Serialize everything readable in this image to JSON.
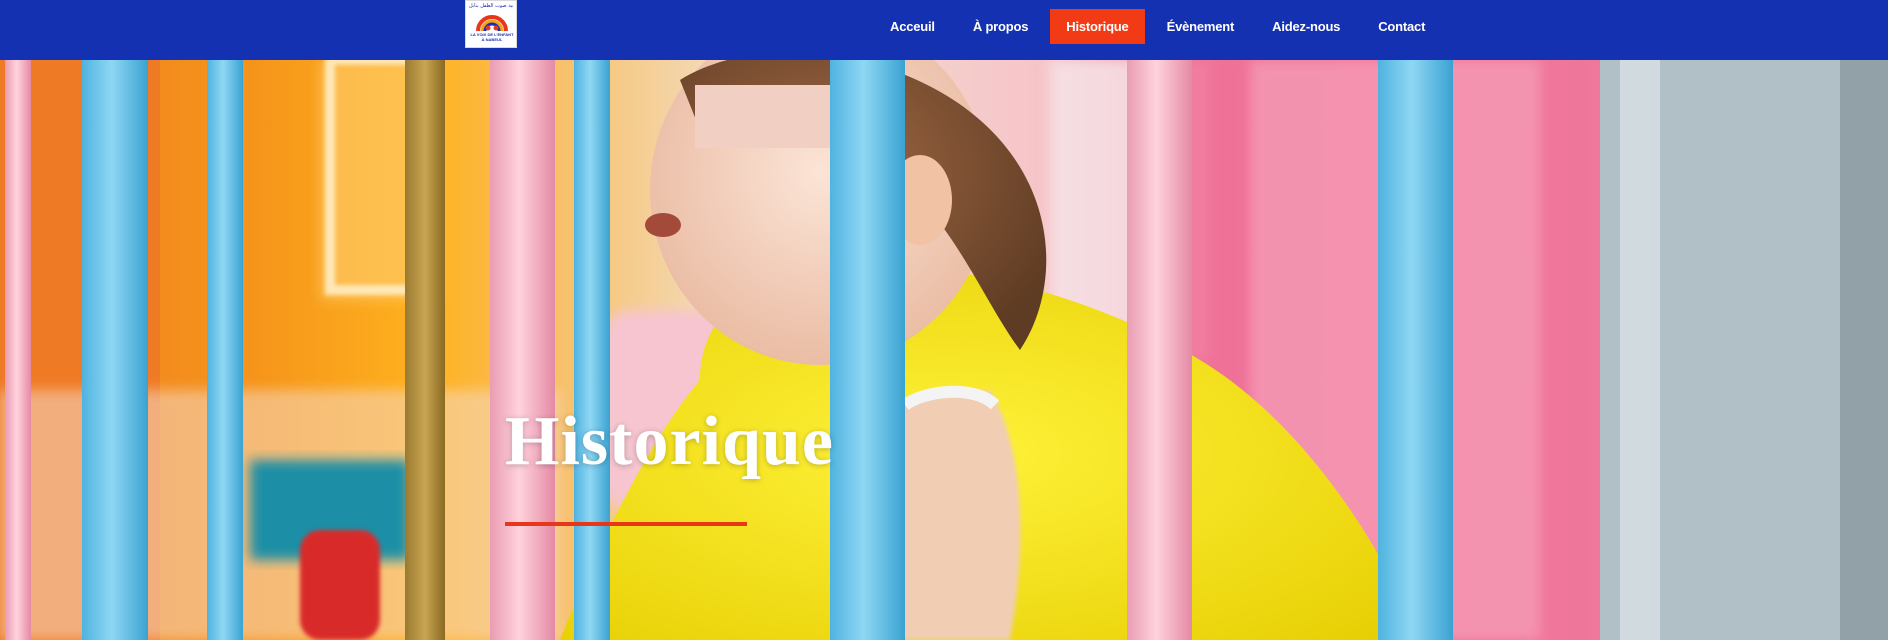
{
  "header": {
    "background": "#1431b1",
    "logo": {
      "arabic_text": "جمعية صوت الطفل بنابل",
      "caption_line1": "LA VOIX DE L'ENFANT",
      "caption_line2": "À NABEUL"
    },
    "nav": [
      {
        "label": "Acceuil",
        "active": false
      },
      {
        "label": "À propos",
        "active": false
      },
      {
        "label": "Historique",
        "active": true
      },
      {
        "label": "Évènement",
        "active": false
      },
      {
        "label": "Aidez-nous",
        "active": false
      },
      {
        "label": "Contact",
        "active": false
      }
    ],
    "active_color": "#f23a14"
  },
  "hero": {
    "title": "Historique",
    "underline_color": "#e8361a",
    "image": "photo-child-crib-colorful-bars"
  }
}
